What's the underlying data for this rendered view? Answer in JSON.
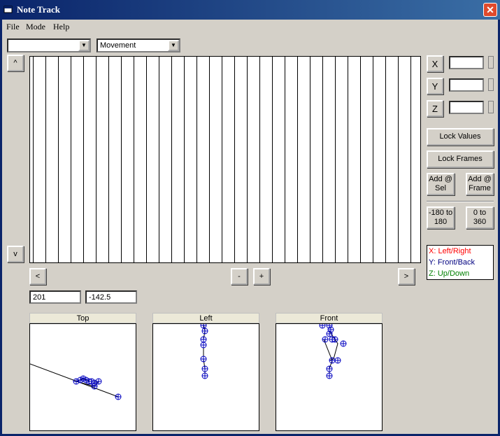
{
  "window": {
    "title": "Note Track"
  },
  "menu": {
    "file": "File",
    "mode": "Mode",
    "help": "Help"
  },
  "combos": {
    "first_value": "",
    "second_value": "Movement"
  },
  "scroll": {
    "up": "^",
    "down": "v",
    "left": "<",
    "right": ">",
    "minus": "-",
    "plus": "+"
  },
  "axis_buttons": {
    "x": "X",
    "y": "Y",
    "z": "Z"
  },
  "actions": {
    "lock_values": "Lock Values",
    "lock_frames": "Lock Frames",
    "add_sel_line1": "Add @",
    "add_sel_line2": "Sel",
    "add_frame_line1": "Add @",
    "add_frame_line2": "Frame",
    "range1_line1": "-180 to",
    "range1_line2": "180",
    "range2_line1": "0 to",
    "range2_line2": "360"
  },
  "legend": {
    "x_label": "X: Left/Right",
    "y_label": "Y: Front/Back",
    "z_label": "Z: Up/Down",
    "x_color": "#ff0000",
    "y_color": "#000080",
    "z_color": "#008000"
  },
  "readouts": {
    "frame": "201",
    "value": "-142.5"
  },
  "views": {
    "top": "Top",
    "left": "Left",
    "front": "Front"
  },
  "marker_color": "#0000c0",
  "icons": {
    "app": "app-icon",
    "close": "close-icon"
  }
}
